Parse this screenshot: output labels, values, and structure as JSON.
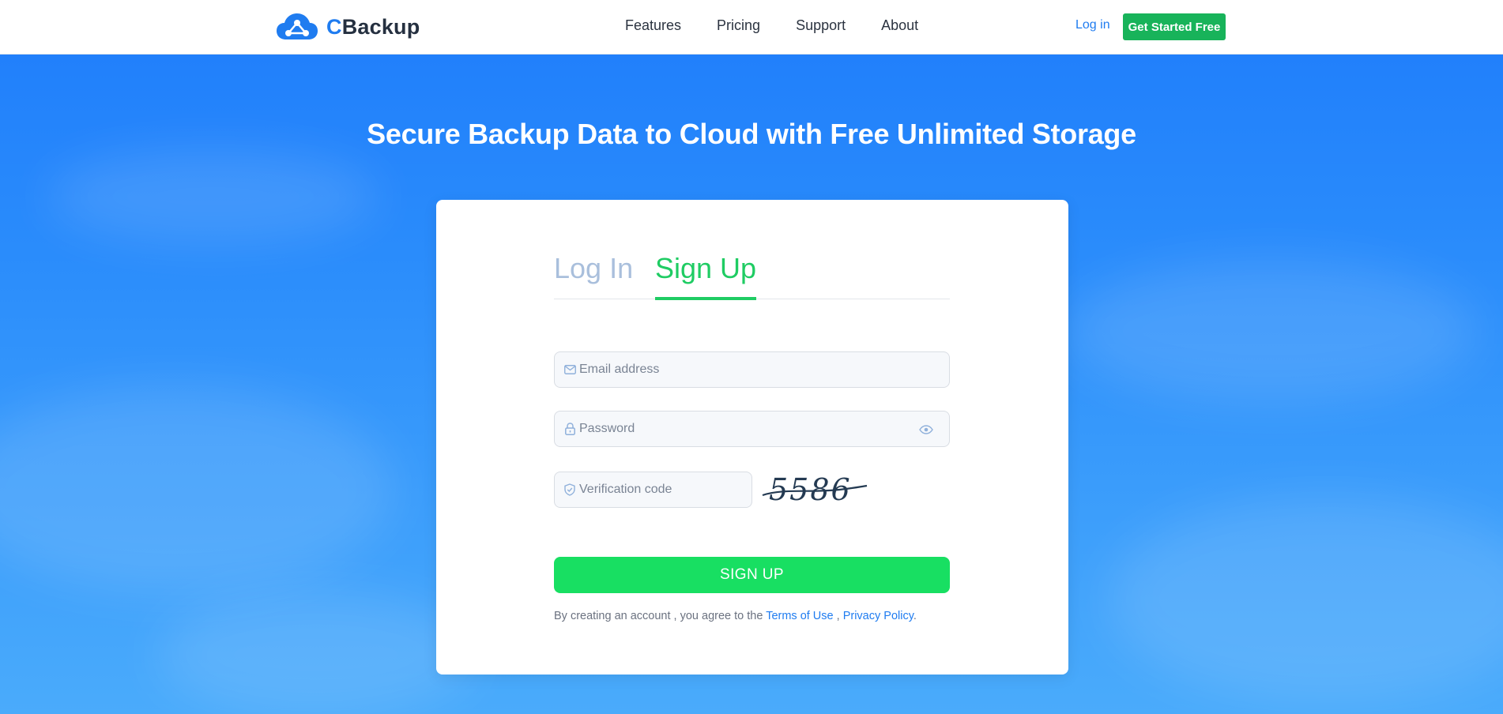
{
  "header": {
    "logo_text": "Backup",
    "logo_c": "C",
    "logo_icon": "cloud-share-icon",
    "nav": [
      "Features",
      "Pricing",
      "Support",
      "About"
    ],
    "login_label": "Log in",
    "cta_label": "Get Started Free"
  },
  "hero": {
    "title": "Secure Backup Data to Cloud with Free Unlimited Storage"
  },
  "form": {
    "tabs": {
      "login": "Log In",
      "signup": "Sign Up",
      "active": "signup"
    },
    "email": {
      "placeholder": "Email address",
      "value": "",
      "icon": "mail-icon"
    },
    "password": {
      "placeholder": "Password",
      "value": "",
      "icon": "lock-icon",
      "toggle_icon": "eye-icon"
    },
    "verification": {
      "placeholder": "Verification code",
      "value": "",
      "icon": "shield-icon"
    },
    "captcha_text": "5586",
    "submit_label": "SIGN UP",
    "terms": {
      "prefix": "By creating an account , you agree to the",
      "terms_link": "Terms of Use",
      "separator": ",",
      "privacy_link": "Privacy Policy",
      "suffix": "."
    }
  },
  "colors": {
    "brand_blue": "#1f7cf0",
    "cta_green": "#18b35a",
    "signup_green": "#18df62",
    "active_tab": "#1fcc63",
    "inactive_tab": "#a9bfdc",
    "hero_top": "#2180fb",
    "hero_bottom": "#4aabfb"
  }
}
